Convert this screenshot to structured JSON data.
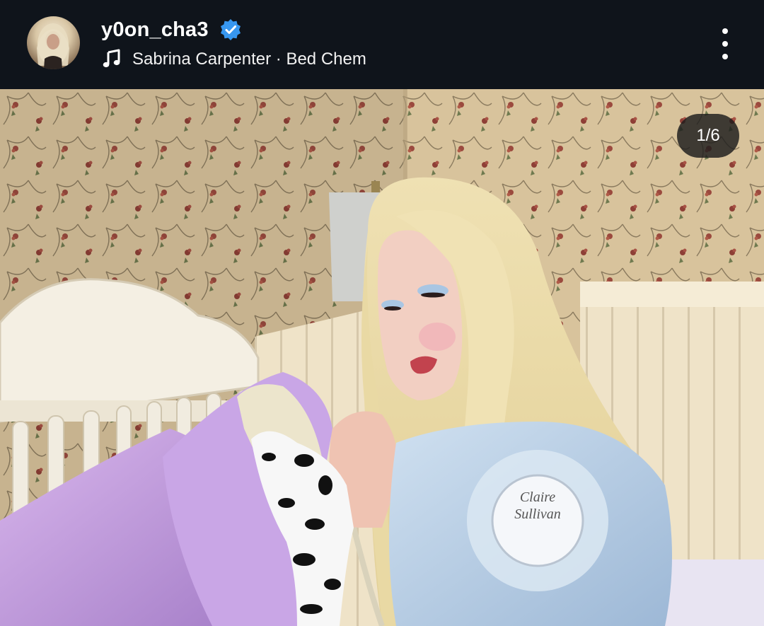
{
  "post": {
    "username": "y0on_cha3",
    "verified": true,
    "song": "Sabrina Carpenter · Bed Chem",
    "carousel_counter": "1/6"
  },
  "photo": {
    "badge_text_line1": "Claire",
    "badge_text_line2": "Sullivan"
  },
  "icons": [
    "avatar",
    "verified-badge-icon",
    "music-note-icon",
    "more-options-icon"
  ],
  "colors": {
    "header_bg": "#0f141b",
    "verified_blue": "#3797f0",
    "text": "#ffffff"
  }
}
